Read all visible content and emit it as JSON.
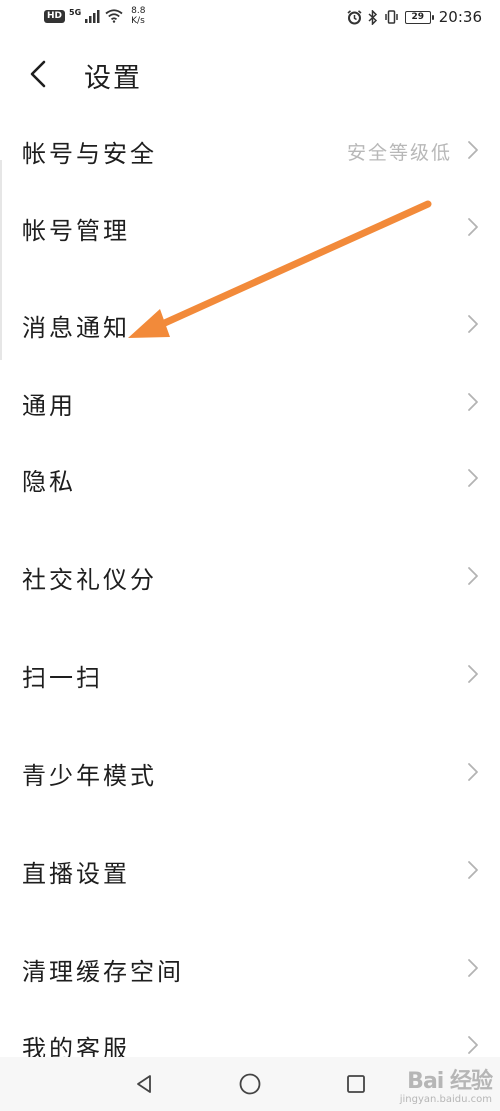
{
  "status_bar": {
    "hd": "HD",
    "network": "5G",
    "speed_value": "8.8",
    "speed_unit": "K/s",
    "battery": "29",
    "time": "20:36"
  },
  "header": {
    "title": "设置"
  },
  "settings": {
    "items": [
      {
        "label": "帐号与安全",
        "value": "安全等级低"
      },
      {
        "label": "帐号管理"
      },
      {
        "label": "消息通知"
      },
      {
        "label": "通用"
      },
      {
        "label": "隐私"
      },
      {
        "label": "社交礼仪分"
      },
      {
        "label": "扫一扫"
      },
      {
        "label": "青少年模式"
      },
      {
        "label": "直播设置"
      },
      {
        "label": "清理缓存空间"
      },
      {
        "label": "我的客服"
      }
    ]
  },
  "watermark": {
    "main": "Bai 经验",
    "sub": "jingyan.baidu.com"
  },
  "colors": {
    "annotation": "#f28a3a",
    "text": "#1e1e1e",
    "secondary": "#b8b8b8"
  }
}
